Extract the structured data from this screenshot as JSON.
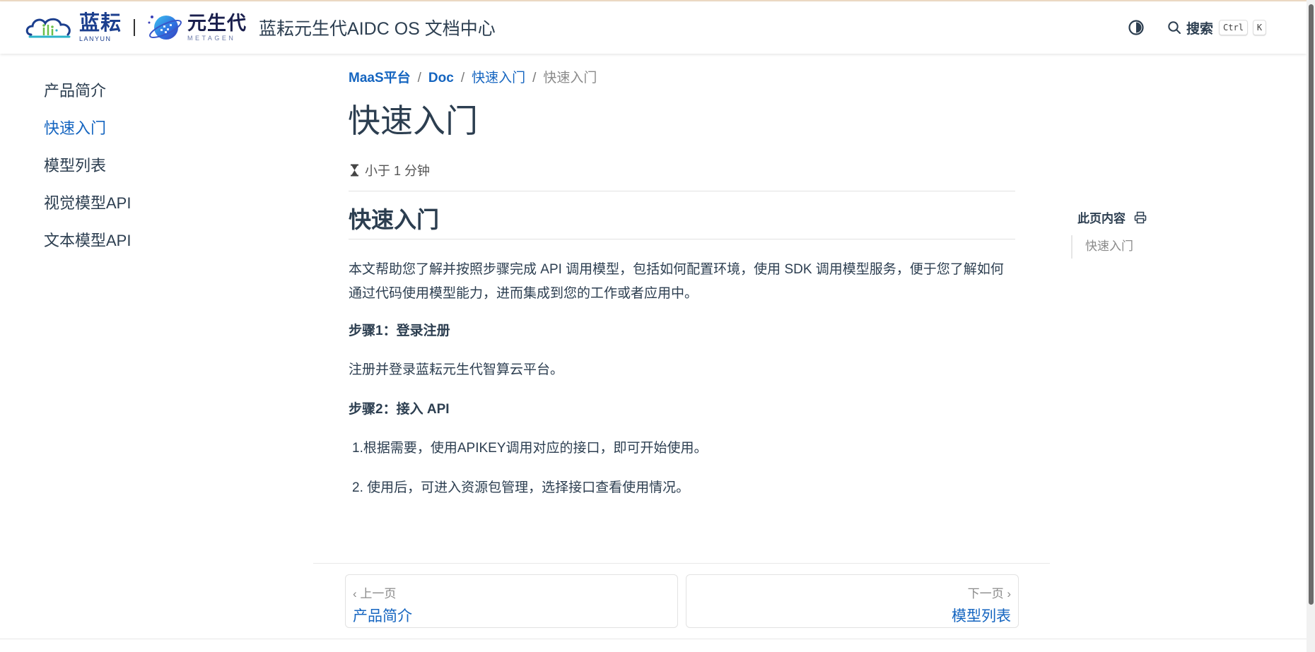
{
  "header": {
    "lanyun_cn": "蓝耘",
    "lanyun_en": "LANYUN",
    "metagen_cn": "元生代",
    "metagen_en": "METAGEN",
    "site_title": "蓝耘元生代AIDC OS 文档中心",
    "search_label": "搜索",
    "kbd_ctrl": "Ctrl",
    "kbd_k": "K",
    "icons": [
      "cloud-logo-icon",
      "planet-logo-icon",
      "theme-toggle-icon",
      "search-icon"
    ]
  },
  "sidebar": {
    "items": [
      {
        "label": "产品简介",
        "active": false
      },
      {
        "label": "快速入门",
        "active": true
      },
      {
        "label": "模型列表",
        "active": false
      },
      {
        "label": "视觉模型API",
        "active": false
      },
      {
        "label": "文本模型API",
        "active": false
      }
    ]
  },
  "breadcrumb": {
    "items": [
      "MaaS平台",
      "Doc",
      "快速入门"
    ],
    "current": "快速入门",
    "separator": "/"
  },
  "page": {
    "title": "快速入门",
    "readtime": "小于 1 分钟",
    "section_heading": "快速入门",
    "intro": "本文帮助您了解并按照步骤完成 API 调用模型，包括如何配置环境，使用 SDK 调用模型服务，便于您了解如何通过代码使用模型能力，进而集成到您的工作或者应用中。",
    "step1_title": "步骤1：登录注册",
    "step1_text": "注册并登录蓝耘元生代智算云平台。",
    "step2_title": "步骤2：接入 API",
    "step2_line1": "1.根据需要，使用APIKEY调用对应的接口，即可开始使用。",
    "step2_line2": "2. 使用后，可进入资源包管理，选择接口查看使用情况。"
  },
  "toc": {
    "title": "此页内容",
    "items": [
      "快速入门"
    ]
  },
  "page_nav": {
    "prev_hint": "上一页",
    "prev_label": "产品简介",
    "next_hint": "下一页",
    "next_label": "模型列表"
  },
  "colors": {
    "link": "#1565c0",
    "text": "#2c3e50",
    "muted": "#8a8a8a"
  }
}
